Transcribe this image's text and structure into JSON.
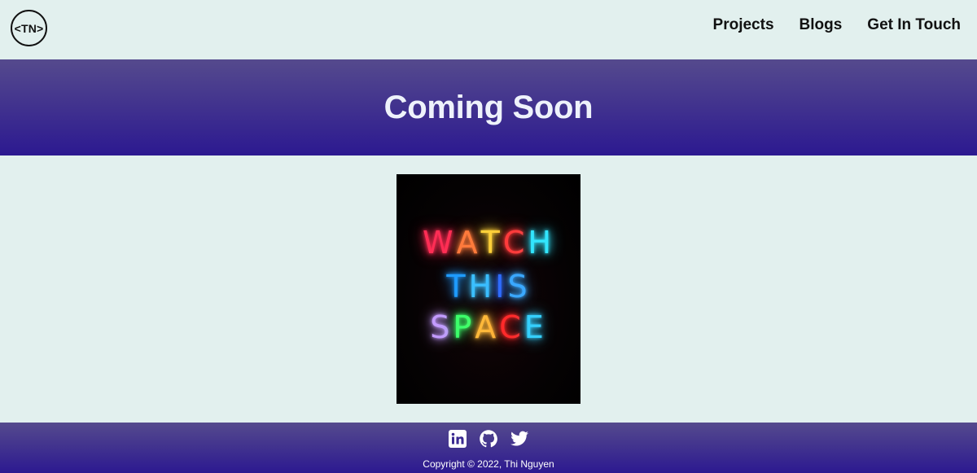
{
  "header": {
    "logo_text": "<TN>",
    "nav": [
      {
        "label": "Projects"
      },
      {
        "label": "Blogs"
      },
      {
        "label": "Get In Touch"
      }
    ]
  },
  "hero": {
    "title": "Coming Soon"
  },
  "poster": {
    "lines": [
      {
        "letters": [
          "W",
          "A",
          "T",
          "C",
          "H"
        ],
        "colors": [
          "#ff2d55",
          "#ff7a3c",
          "#ffd23a",
          "#ff3b3b",
          "#32e6ff"
        ]
      },
      {
        "letters": [
          "T",
          "H",
          "I",
          "S"
        ],
        "colors": [
          "#1f9bff",
          "#3bc0ff",
          "#2f6bff",
          "#3aa8ff"
        ]
      },
      {
        "letters": [
          "S",
          "P",
          "A",
          "C",
          "E"
        ],
        "colors": [
          "#c39bff",
          "#3cff6b",
          "#ffb93a",
          "#ff2a2a",
          "#35d0ff"
        ]
      }
    ]
  },
  "footer": {
    "icons": [
      "linkedin-icon",
      "github-icon",
      "twitter-icon"
    ],
    "copyright": "Copyright © 2022, Thi Nguyen"
  }
}
